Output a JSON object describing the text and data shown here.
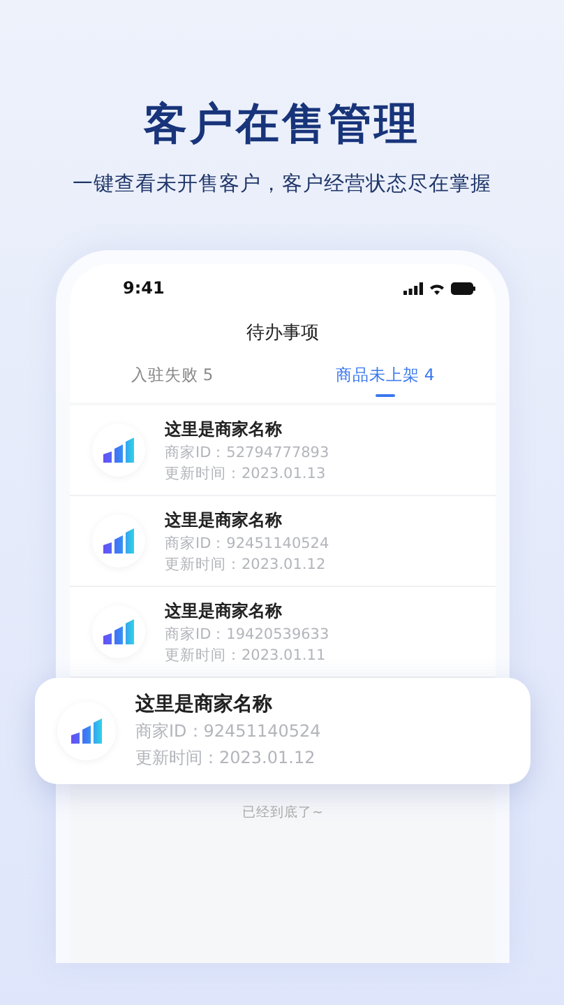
{
  "headline": "客户在售管理",
  "subtitle": "一键查看未开售客户，客户经营状态尽在掌握",
  "status_bar": {
    "time": "9:41"
  },
  "screen_title": "待办事项",
  "tabs": [
    {
      "label": "入驻失败 5",
      "selected": false
    },
    {
      "label": "商品未上架 4",
      "selected": true
    }
  ],
  "merchants": [
    {
      "kind": "row",
      "name": "这里是商家名称",
      "merchant_id": "商家ID：52794777893",
      "updated": "更新时间：2023.01.13"
    },
    {
      "kind": "row",
      "name": "这里是商家名称",
      "merchant_id": "商家ID：92451140524",
      "updated": "更新时间：2023.01.12"
    },
    {
      "kind": "row",
      "name": "这里是商家名称",
      "merchant_id": "商家ID：19420539633",
      "updated": "更新时间：2023.01.11"
    },
    {
      "kind": "card",
      "name": "这里是商家名称",
      "merchant_id": "商家ID：92451140524",
      "updated": "更新时间：2023.01.12"
    }
  ],
  "end_note": "已经到底了~"
}
